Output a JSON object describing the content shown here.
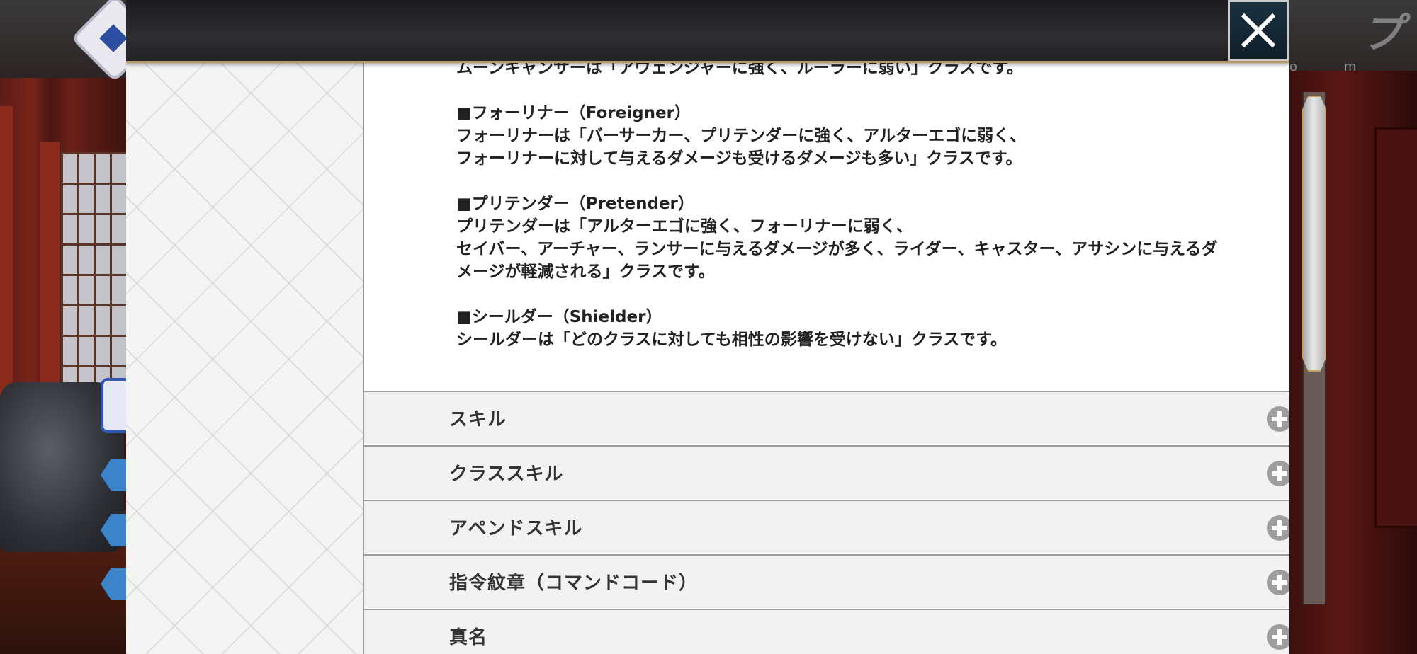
{
  "background": {
    "top_right_label": "プ",
    "top_right_sub": "o m"
  },
  "dialog": {
    "close_icon": "close-x-icon",
    "paragraphs": [
      {
        "lines": [
          "ムーンキャンサーは「アヴェンジャーに強く、ルーラーに弱い」クラスです。"
        ]
      },
      {
        "heading": "■フォーリナー（Foreigner）",
        "lines": [
          "フォーリナーは「バーサーカー、プリテンダーに強く、アルターエゴに弱く、",
          "フォーリナーに対して与えるダメージも受けるダメージも多い」クラスです。"
        ]
      },
      {
        "heading": "■プリテンダー（Pretender）",
        "lines": [
          "プリテンダーは「アルターエゴに強く、フォーリナーに弱く、",
          "セイバー、アーチャー、ランサーに与えるダメージが多く、ライダー、キャスター、アサシンに与えるダ",
          "メージが軽減される」クラスです。"
        ]
      },
      {
        "heading": "■シールダー（Shielder）",
        "lines": [
          "シールダーは「どのクラスに対しても相性の影響を受けない」クラスです。"
        ]
      }
    ],
    "sections": [
      {
        "label": "スキル",
        "icon": "plus-circle-icon"
      },
      {
        "label": "クラススキル",
        "icon": "plus-circle-icon"
      },
      {
        "label": "アペンドスキル",
        "icon": "plus-circle-icon"
      },
      {
        "label": "指令紋章（コマンドコード）",
        "icon": "plus-circle-icon"
      },
      {
        "label": "真名",
        "icon": "plus-circle-icon"
      }
    ]
  },
  "colors": {
    "header_border": "#b79a63",
    "accordion_bg": "#f2f2f2",
    "plus_icon": "#9e9e9e",
    "close_button_bg": "#1a3140"
  }
}
